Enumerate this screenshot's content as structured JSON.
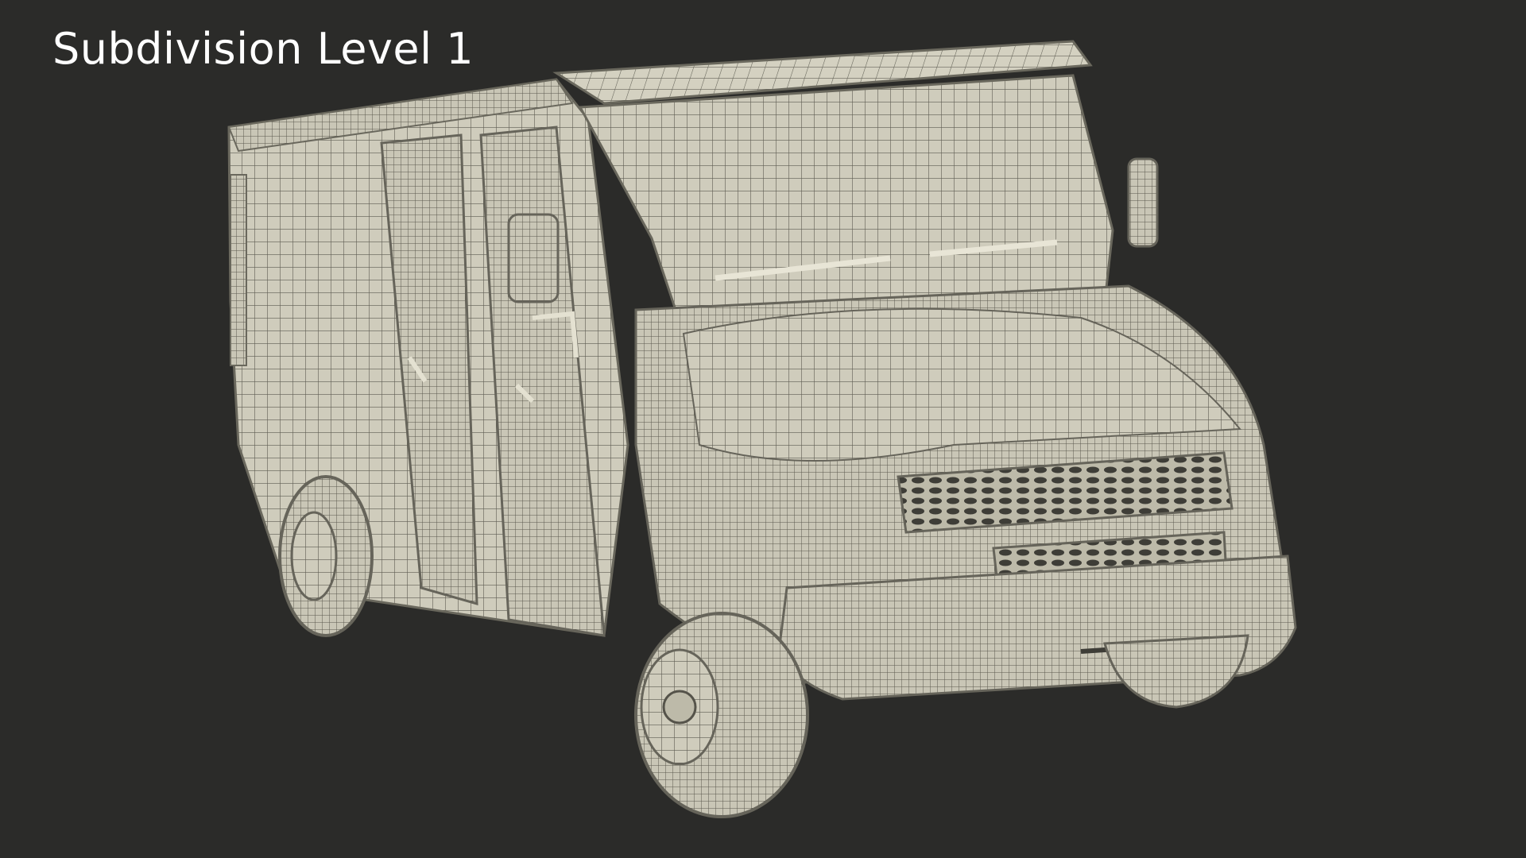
{
  "caption": "Subdivision Level 1",
  "colors": {
    "background": "#2b2b29",
    "surface": "#cfccbc",
    "surface_shade": "#b5b2a2",
    "wire": "#5e5c52"
  }
}
